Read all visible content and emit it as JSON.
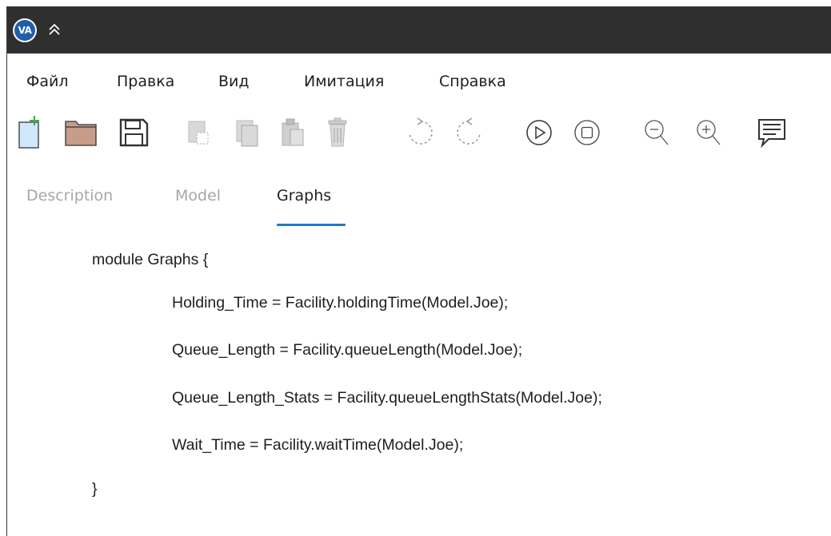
{
  "titlebar": {
    "logo_text": "VA",
    "logo_color": "#1f5fa8",
    "background": "#2f2f2f",
    "collapse_icon": "double-chevron-up-icon"
  },
  "menu": {
    "items": [
      "Файл",
      "Правка",
      "Вид",
      "Имитация",
      "Справка"
    ]
  },
  "toolbar": {
    "buttons": [
      {
        "icon": "new-file-icon",
        "enabled": true
      },
      {
        "icon": "open-folder-icon",
        "enabled": true
      },
      {
        "icon": "save-icon",
        "enabled": true
      },
      {
        "icon": "cut-icon",
        "enabled": false
      },
      {
        "icon": "copy-icon",
        "enabled": false
      },
      {
        "icon": "paste-icon",
        "enabled": false
      },
      {
        "icon": "delete-icon",
        "enabled": false
      },
      {
        "icon": "undo-icon",
        "enabled": false
      },
      {
        "icon": "redo-icon",
        "enabled": false
      },
      {
        "icon": "play-icon",
        "enabled": true
      },
      {
        "icon": "stop-icon",
        "enabled": true
      },
      {
        "icon": "zoom-out-icon",
        "enabled": true
      },
      {
        "icon": "zoom-in-icon",
        "enabled": true
      },
      {
        "icon": "comment-icon",
        "enabled": true
      }
    ]
  },
  "tabs": {
    "items": [
      "Description",
      "Model",
      "Graphs"
    ],
    "active": "Graphs",
    "accent": "#1f79c8"
  },
  "code": {
    "lines": [
      "module Graphs {",
      "Holding_Time = Facility.holdingTime(Model.Joe);",
      "Queue_Length = Facility.queueLength(Model.Joe);",
      "Queue_Length_Stats = Facility.queueLengthStats(Model.Joe);",
      "Wait_Time = Facility.waitTime(Model.Joe);",
      "}"
    ]
  }
}
